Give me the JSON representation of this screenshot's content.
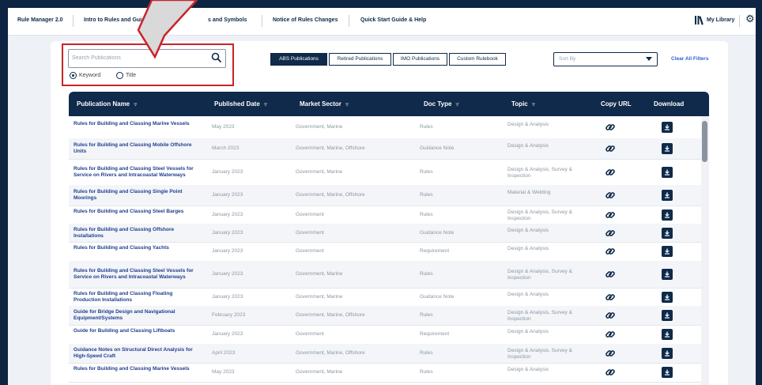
{
  "app": {
    "title": "Rule Manager 2.0"
  },
  "nav": {
    "items": [
      "Intro to Rules and Guides",
      "s and Symbols",
      "Notice of Rules Changes",
      "Quick Start Guide & Help"
    ],
    "library": "My Library"
  },
  "search": {
    "placeholder": "Search Publications",
    "value": ""
  },
  "search_mode": {
    "options": [
      "Keyword",
      "Title"
    ],
    "selected": "Keyword"
  },
  "tabs": {
    "items": [
      "ABS Publications",
      "Retired Publications",
      "IMO Publications",
      "Custom Rulebook"
    ],
    "active": "ABS Publications"
  },
  "sort": {
    "placeholder": "Sort By"
  },
  "clear_filters": "Clear All Filters",
  "table": {
    "columns": [
      "Publication Name",
      "Published Date",
      "Market Sector",
      "Doc Type",
      "Topic",
      "Copy URL",
      "Download"
    ],
    "rows": [
      {
        "name": "Rules for Building and Classing Marine Vessels",
        "date": "May 2023",
        "market": "Government, Marine",
        "doc_type": "Rules",
        "topic": "Design & Analysis"
      },
      {
        "name": "Rules for Building and Classing Mobile Offshore Units",
        "date": "March 2023",
        "market": "Government, Marine, Offshore",
        "doc_type": "Guidance Note",
        "topic": "Design & Analysis"
      },
      {
        "name": "Rules for Building and Classing Steel Vessels for Service on Rivers and Intracoastal Waterways",
        "date": "January 2023",
        "market": "Government, Marine",
        "doc_type": "Rules",
        "topic": "Design & Analysis, Survey & Inspection"
      },
      {
        "name": "Rules for Building and Classing Single Point Moorings",
        "date": "January 2023",
        "market": "Government, Marine, Offshore",
        "doc_type": "Rules",
        "topic": "Material & Welding"
      },
      {
        "name": "Rules for Building and Classing Steel Barges",
        "date": "January 2023",
        "market": "Government",
        "doc_type": "Rules",
        "topic": "Design & Analysis, Survey & Inspection"
      },
      {
        "name": "Rules for Building and Classing Offshore Installations",
        "date": "January 2023",
        "market": "Government",
        "doc_type": "Guidance Note",
        "topic": "Design & Analysis"
      },
      {
        "name": "Rules for Building and Classing Yachts",
        "date": "January 2023",
        "market": "Government",
        "doc_type": "Requirement",
        "topic": "Design & Analysis"
      },
      {
        "name": "Rules for Building and Classing Steel Vessels for Service on Rivers and Intracoastal Waterways",
        "date": "January 2023",
        "market": "Government, Marine",
        "doc_type": "Rules",
        "topic": "Design & Analysis, Survey & Inspection"
      },
      {
        "name": "Rules for Building and Classing Floating Production Installations",
        "date": "January 2023",
        "market": "Government, Marine",
        "doc_type": "Guidance Note",
        "topic": "Design & Analysis"
      },
      {
        "name": "Guide for Bridge Design and Navigational Equipment/Systems",
        "date": "February 2023",
        "market": "Government, Marine, Offshore",
        "doc_type": "Rules",
        "topic": "Design & Analysis, Survey & Inspection"
      },
      {
        "name": "Guide for Building and Classing Liftboats",
        "date": "January 2023",
        "market": "Government",
        "doc_type": "Requirement",
        "topic": "Design & Analysis"
      },
      {
        "name": "Guidance Notes on Structural Direct Analysis for High-Speed Craft",
        "date": "April 2023",
        "market": "Government, Marine, Offshore",
        "doc_type": "Rules",
        "topic": "Design & Analysis, Survey & Inspection"
      },
      {
        "name": "Rules for Building and Classing Marine Vessels",
        "date": "May 2023",
        "market": "Government, Marine",
        "doc_type": "Rules",
        "topic": "Design & Analysis"
      }
    ]
  },
  "colors": {
    "navy": "#0f2a4a",
    "highlight_red": "#c9242b",
    "link_blue": "#1f3e8f"
  },
  "icons": {
    "library": "library-icon",
    "settings": "gear-icon",
    "search": "search-icon",
    "copy_url": "link-icon",
    "download": "download-icon",
    "filter": "filter-icon"
  }
}
